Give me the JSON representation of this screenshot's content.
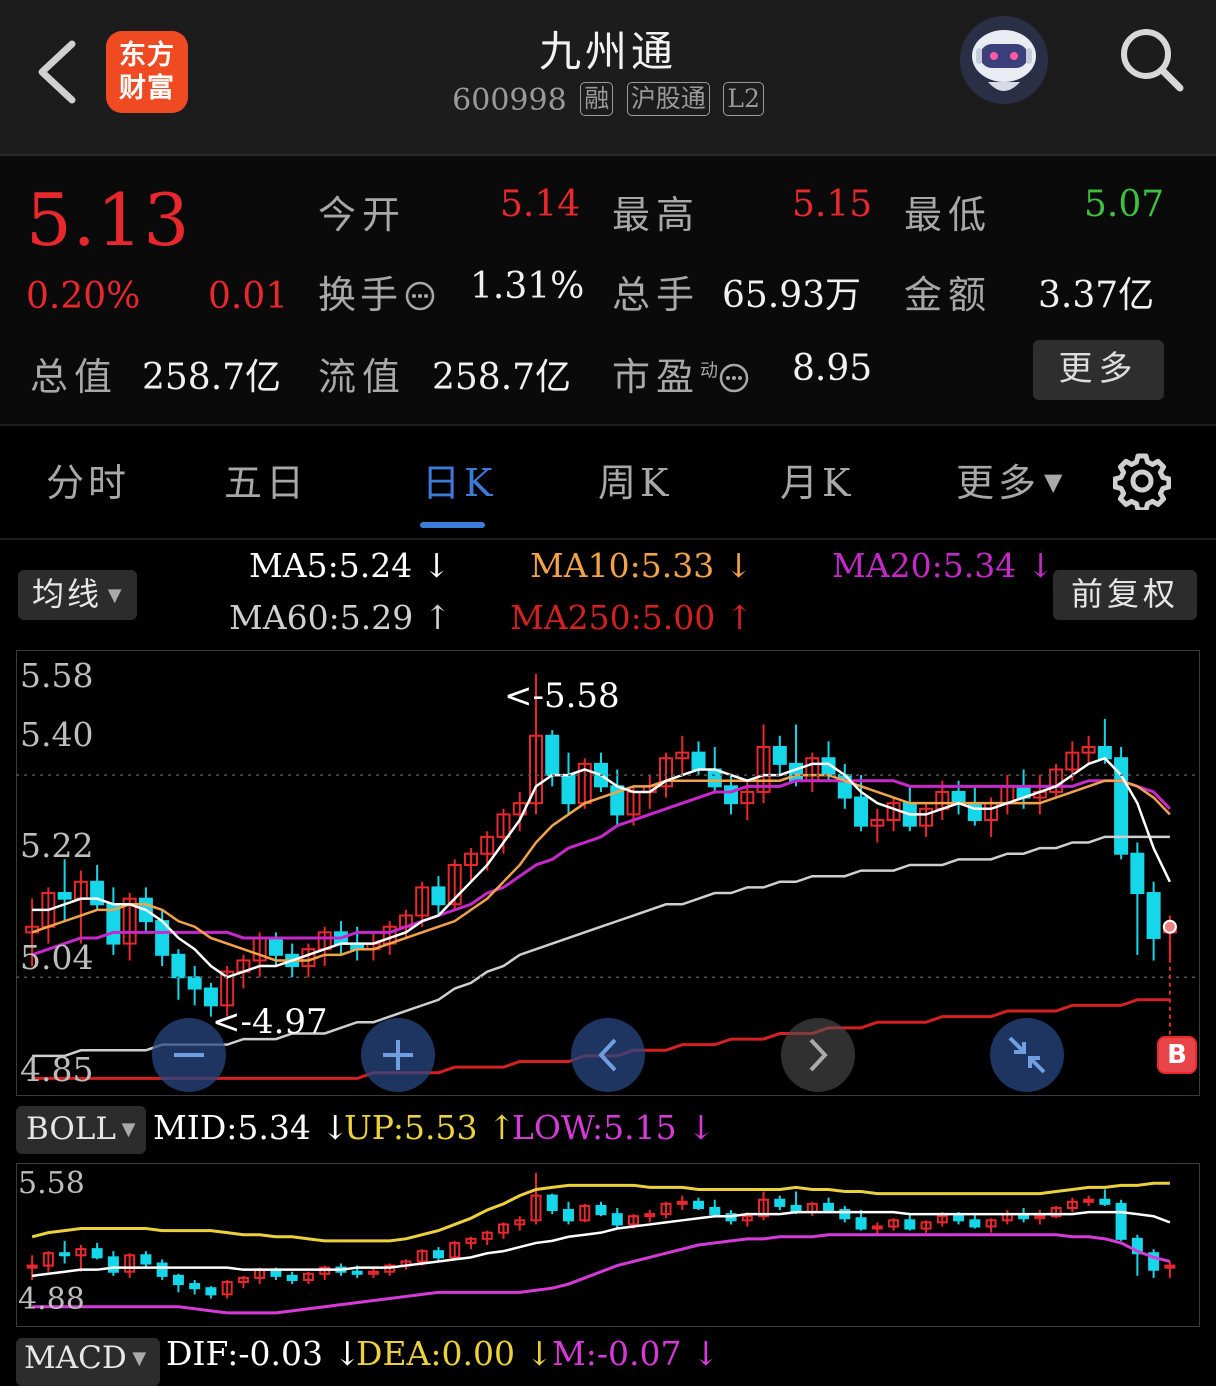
{
  "header": {
    "title": "九州通",
    "code": "600998",
    "tags": [
      "融",
      "沪股通",
      "L2"
    ],
    "logo_line1": "东方",
    "logo_line2": "财富"
  },
  "quote": {
    "price": "5.13",
    "change_pct": "0.20%",
    "change": "0.01",
    "open_label": "今开",
    "open": "5.14",
    "high_label": "最高",
    "high": "5.15",
    "low_label": "最低",
    "low": "5.07",
    "turnover_label": "换手",
    "turnover": "1.31%",
    "volume_label": "总手",
    "volume": "65.93万",
    "amount_label": "金额",
    "amount": "3.37亿",
    "mktcap_label": "总值",
    "mktcap": "258.7亿",
    "float_label": "流值",
    "float_cap": "258.7亿",
    "pe_label": "市盈",
    "pe_sup": "动",
    "pe": "8.95",
    "more": "更多"
  },
  "tabs": [
    "分时",
    "五日",
    "日K",
    "周K",
    "月K",
    "更多"
  ],
  "indicator_bar": {
    "ma_button": "均线",
    "adjust_button": "前复权",
    "ma5": "MA5:5.24",
    "ma10": "MA10:5.33",
    "ma20": "MA20:5.34",
    "ma60": "MA60:5.29",
    "ma250": "MA250:5.00",
    "down_arrow": "↓",
    "up_arrow": "↑"
  },
  "main_chart": {
    "y_labels": [
      "5.58",
      "5.40",
      "5.22",
      "5.04",
      "4.85"
    ],
    "max_marker": "<-5.58",
    "min_marker": "<-4.97",
    "b_marker": "B"
  },
  "boll_bar": {
    "button": "BOLL",
    "mid": "MID:5.34",
    "up": "UP:5.53",
    "low": "LOW:5.15"
  },
  "boll_chart": {
    "y_labels": [
      "5.58",
      "4.88"
    ]
  },
  "macd_bar": {
    "button": "MACD",
    "dif": "DIF:-0.03",
    "dea": "DEA:0.00",
    "m": "M:-0.07"
  },
  "colors": {
    "up": "#e8282d",
    "down": "#16d7ea",
    "ma5": "#ffffff",
    "ma10": "#f2a34a",
    "ma20": "#c628c9",
    "ma60": "#cfcfcf",
    "ma250": "#d42020",
    "accent": "#3d7bd8"
  },
  "chart_data": {
    "type": "candlestick",
    "ylim": [
      4.85,
      5.58
    ],
    "candles": [
      [
        5.12,
        5.18,
        5.06,
        5.13
      ],
      [
        5.13,
        5.2,
        5.1,
        5.19
      ],
      [
        5.19,
        5.25,
        5.14,
        5.18
      ],
      [
        5.18,
        5.23,
        5.1,
        5.21
      ],
      [
        5.21,
        5.24,
        5.16,
        5.17
      ],
      [
        5.17,
        5.2,
        5.08,
        5.1
      ],
      [
        5.1,
        5.19,
        5.07,
        5.18
      ],
      [
        5.18,
        5.2,
        5.12,
        5.14
      ],
      [
        5.14,
        5.16,
        5.06,
        5.08
      ],
      [
        5.08,
        5.09,
        5.0,
        5.04
      ],
      [
        5.04,
        5.06,
        4.99,
        5.02
      ],
      [
        5.02,
        5.03,
        4.97,
        4.99
      ],
      [
        4.99,
        5.06,
        4.97,
        5.05
      ],
      [
        5.05,
        5.08,
        5.02,
        5.07
      ],
      [
        5.07,
        5.12,
        5.04,
        5.11
      ],
      [
        5.11,
        5.12,
        5.06,
        5.08
      ],
      [
        5.08,
        5.1,
        5.04,
        5.06
      ],
      [
        5.06,
        5.1,
        5.04,
        5.09
      ],
      [
        5.09,
        5.13,
        5.06,
        5.12
      ],
      [
        5.12,
        5.14,
        5.08,
        5.1
      ],
      [
        5.1,
        5.13,
        5.07,
        5.09
      ],
      [
        5.09,
        5.12,
        5.07,
        5.1
      ],
      [
        5.1,
        5.14,
        5.08,
        5.13
      ],
      [
        5.13,
        5.16,
        5.11,
        5.15
      ],
      [
        5.15,
        5.21,
        5.13,
        5.2
      ],
      [
        5.2,
        5.22,
        5.15,
        5.17
      ],
      [
        5.17,
        5.25,
        5.16,
        5.24
      ],
      [
        5.24,
        5.27,
        5.21,
        5.26
      ],
      [
        5.26,
        5.3,
        5.23,
        5.29
      ],
      [
        5.29,
        5.34,
        5.26,
        5.33
      ],
      [
        5.33,
        5.37,
        5.3,
        5.35
      ],
      [
        5.35,
        5.58,
        5.33,
        5.47
      ],
      [
        5.47,
        5.48,
        5.38,
        5.4
      ],
      [
        5.4,
        5.44,
        5.33,
        5.35
      ],
      [
        5.35,
        5.43,
        5.34,
        5.42
      ],
      [
        5.42,
        5.44,
        5.37,
        5.38
      ],
      [
        5.38,
        5.41,
        5.31,
        5.33
      ],
      [
        5.33,
        5.38,
        5.31,
        5.37
      ],
      [
        5.37,
        5.4,
        5.34,
        5.38
      ],
      [
        5.38,
        5.44,
        5.36,
        5.43
      ],
      [
        5.43,
        5.47,
        5.4,
        5.44
      ],
      [
        5.44,
        5.46,
        5.4,
        5.41
      ],
      [
        5.41,
        5.45,
        5.37,
        5.38
      ],
      [
        5.38,
        5.4,
        5.33,
        5.35
      ],
      [
        5.35,
        5.39,
        5.32,
        5.37
      ],
      [
        5.37,
        5.49,
        5.35,
        5.45
      ],
      [
        5.45,
        5.47,
        5.4,
        5.42
      ],
      [
        5.42,
        5.49,
        5.38,
        5.39
      ],
      [
        5.39,
        5.44,
        5.37,
        5.43
      ],
      [
        5.43,
        5.46,
        5.39,
        5.4
      ],
      [
        5.4,
        5.42,
        5.34,
        5.36
      ],
      [
        5.36,
        5.4,
        5.3,
        5.31
      ],
      [
        5.31,
        5.34,
        5.28,
        5.32
      ],
      [
        5.32,
        5.36,
        5.3,
        5.35
      ],
      [
        5.35,
        5.38,
        5.3,
        5.31
      ],
      [
        5.31,
        5.35,
        5.29,
        5.34
      ],
      [
        5.34,
        5.39,
        5.32,
        5.37
      ],
      [
        5.37,
        5.39,
        5.33,
        5.35
      ],
      [
        5.35,
        5.38,
        5.31,
        5.32
      ],
      [
        5.32,
        5.36,
        5.29,
        5.35
      ],
      [
        5.35,
        5.4,
        5.33,
        5.38
      ],
      [
        5.38,
        5.41,
        5.34,
        5.36
      ],
      [
        5.36,
        5.4,
        5.33,
        5.37
      ],
      [
        5.37,
        5.42,
        5.36,
        5.41
      ],
      [
        5.41,
        5.46,
        5.39,
        5.44
      ],
      [
        5.44,
        5.47,
        5.42,
        5.45
      ],
      [
        5.45,
        5.5,
        5.42,
        5.43
      ],
      [
        5.43,
        5.45,
        5.25,
        5.26
      ],
      [
        5.26,
        5.28,
        5.08,
        5.19
      ],
      [
        5.19,
        5.21,
        5.07,
        5.11
      ],
      [
        5.12,
        5.15,
        5.07,
        5.13
      ]
    ],
    "ma5": [
      5.16,
      5.16,
      5.17,
      5.18,
      5.18,
      5.17,
      5.17,
      5.16,
      5.14,
      5.11,
      5.09,
      5.06,
      5.04,
      5.05,
      5.06,
      5.06,
      5.07,
      5.08,
      5.09,
      5.1,
      5.1,
      5.1,
      5.11,
      5.12,
      5.14,
      5.15,
      5.18,
      5.21,
      5.24,
      5.28,
      5.32,
      5.38,
      5.4,
      5.4,
      5.41,
      5.4,
      5.38,
      5.37,
      5.37,
      5.39,
      5.4,
      5.41,
      5.41,
      5.4,
      5.39,
      5.4,
      5.4,
      5.41,
      5.42,
      5.42,
      5.4,
      5.37,
      5.35,
      5.34,
      5.33,
      5.33,
      5.34,
      5.35,
      5.34,
      5.34,
      5.35,
      5.36,
      5.37,
      5.38,
      5.4,
      5.42,
      5.43,
      5.4,
      5.35,
      5.27,
      5.21
    ],
    "ma10": [
      5.12,
      5.13,
      5.14,
      5.15,
      5.16,
      5.16,
      5.17,
      5.17,
      5.16,
      5.14,
      5.13,
      5.11,
      5.1,
      5.09,
      5.08,
      5.07,
      5.07,
      5.07,
      5.08,
      5.08,
      5.09,
      5.09,
      5.1,
      5.11,
      5.12,
      5.13,
      5.14,
      5.16,
      5.18,
      5.21,
      5.24,
      5.28,
      5.31,
      5.33,
      5.35,
      5.36,
      5.37,
      5.38,
      5.38,
      5.39,
      5.39,
      5.39,
      5.39,
      5.39,
      5.39,
      5.39,
      5.39,
      5.4,
      5.4,
      5.4,
      5.39,
      5.38,
      5.37,
      5.36,
      5.35,
      5.35,
      5.35,
      5.35,
      5.35,
      5.35,
      5.35,
      5.35,
      5.35,
      5.36,
      5.37,
      5.38,
      5.39,
      5.39,
      5.38,
      5.36,
      5.33
    ],
    "ma20": [
      5.08,
      5.09,
      5.1,
      5.11,
      5.11,
      5.12,
      5.12,
      5.12,
      5.12,
      5.12,
      5.12,
      5.12,
      5.12,
      5.11,
      5.11,
      5.11,
      5.11,
      5.11,
      5.11,
      5.11,
      5.12,
      5.12,
      5.12,
      5.13,
      5.14,
      5.15,
      5.16,
      5.17,
      5.19,
      5.2,
      5.22,
      5.24,
      5.25,
      5.27,
      5.28,
      5.29,
      5.31,
      5.32,
      5.33,
      5.34,
      5.35,
      5.36,
      5.37,
      5.37,
      5.38,
      5.38,
      5.38,
      5.39,
      5.39,
      5.39,
      5.39,
      5.39,
      5.39,
      5.39,
      5.38,
      5.38,
      5.38,
      5.38,
      5.38,
      5.38,
      5.38,
      5.38,
      5.38,
      5.38,
      5.38,
      5.39,
      5.39,
      5.39,
      5.38,
      5.37,
      5.34
    ],
    "ma60": [
      4.9,
      4.9,
      4.9,
      4.91,
      4.91,
      4.91,
      4.91,
      4.91,
      4.92,
      4.92,
      4.92,
      4.92,
      4.92,
      4.93,
      4.93,
      4.93,
      4.94,
      4.94,
      4.94,
      4.95,
      4.96,
      4.96,
      4.97,
      4.98,
      4.99,
      5.0,
      5.02,
      5.03,
      5.05,
      5.06,
      5.08,
      5.09,
      5.1,
      5.11,
      5.12,
      5.13,
      5.14,
      5.15,
      5.16,
      5.17,
      5.17,
      5.18,
      5.19,
      5.19,
      5.2,
      5.2,
      5.21,
      5.21,
      5.22,
      5.22,
      5.22,
      5.23,
      5.23,
      5.23,
      5.24,
      5.24,
      5.24,
      5.25,
      5.25,
      5.25,
      5.26,
      5.26,
      5.27,
      5.27,
      5.28,
      5.28,
      5.29,
      5.29,
      5.29,
      5.29,
      5.29
    ],
    "ma250": [
      4.86,
      4.86,
      4.86,
      4.86,
      4.86,
      4.86,
      4.86,
      4.86,
      4.86,
      4.86,
      4.86,
      4.86,
      4.86,
      4.86,
      4.86,
      4.86,
      4.86,
      4.86,
      4.86,
      4.86,
      4.86,
      4.87,
      4.87,
      4.87,
      4.87,
      4.87,
      4.88,
      4.88,
      4.88,
      4.88,
      4.89,
      4.89,
      4.89,
      4.89,
      4.9,
      4.9,
      4.9,
      4.91,
      4.91,
      4.91,
      4.92,
      4.92,
      4.92,
      4.93,
      4.93,
      4.93,
      4.94,
      4.94,
      4.94,
      4.95,
      4.95,
      4.95,
      4.96,
      4.96,
      4.96,
      4.96,
      4.97,
      4.97,
      4.97,
      4.97,
      4.98,
      4.98,
      4.98,
      4.98,
      4.99,
      4.99,
      4.99,
      4.99,
      5.0,
      5.0,
      5.0
    ],
    "boll_ylim": [
      4.88,
      5.58
    ],
    "boll_up": [
      5.27,
      5.29,
      5.3,
      5.31,
      5.31,
      5.31,
      5.31,
      5.31,
      5.3,
      5.3,
      5.3,
      5.3,
      5.29,
      5.28,
      5.28,
      5.27,
      5.27,
      5.26,
      5.25,
      5.25,
      5.25,
      5.25,
      5.25,
      5.26,
      5.28,
      5.3,
      5.33,
      5.36,
      5.4,
      5.43,
      5.47,
      5.5,
      5.51,
      5.52,
      5.52,
      5.52,
      5.52,
      5.52,
      5.51,
      5.51,
      5.51,
      5.5,
      5.5,
      5.5,
      5.5,
      5.5,
      5.5,
      5.51,
      5.5,
      5.5,
      5.49,
      5.49,
      5.48,
      5.48,
      5.48,
      5.48,
      5.48,
      5.48,
      5.48,
      5.48,
      5.48,
      5.48,
      5.48,
      5.49,
      5.5,
      5.51,
      5.51,
      5.52,
      5.52,
      5.53,
      5.53
    ],
    "boll_mid": [
      5.08,
      5.09,
      5.1,
      5.11,
      5.11,
      5.12,
      5.12,
      5.12,
      5.12,
      5.12,
      5.12,
      5.12,
      5.12,
      5.11,
      5.11,
      5.11,
      5.11,
      5.11,
      5.11,
      5.11,
      5.12,
      5.12,
      5.12,
      5.13,
      5.14,
      5.15,
      5.16,
      5.17,
      5.19,
      5.2,
      5.22,
      5.24,
      5.25,
      5.27,
      5.28,
      5.29,
      5.31,
      5.32,
      5.33,
      5.34,
      5.35,
      5.36,
      5.37,
      5.37,
      5.38,
      5.38,
      5.38,
      5.39,
      5.39,
      5.39,
      5.39,
      5.39,
      5.39,
      5.39,
      5.38,
      5.38,
      5.38,
      5.38,
      5.38,
      5.38,
      5.38,
      5.38,
      5.38,
      5.38,
      5.38,
      5.39,
      5.39,
      5.39,
      5.38,
      5.37,
      5.34
    ],
    "boll_low": [
      4.93,
      4.93,
      4.93,
      4.93,
      4.93,
      4.93,
      4.93,
      4.93,
      4.93,
      4.93,
      4.92,
      4.91,
      4.9,
      4.9,
      4.9,
      4.9,
      4.91,
      4.92,
      4.93,
      4.94,
      4.95,
      4.96,
      4.97,
      4.98,
      4.99,
      5.0,
      5.0,
      5.0,
      5.0,
      5.0,
      5.0,
      5.01,
      5.02,
      5.04,
      5.07,
      5.1,
      5.13,
      5.15,
      5.17,
      5.19,
      5.21,
      5.23,
      5.24,
      5.25,
      5.26,
      5.26,
      5.27,
      5.27,
      5.27,
      5.28,
      5.28,
      5.28,
      5.28,
      5.28,
      5.28,
      5.28,
      5.28,
      5.28,
      5.28,
      5.28,
      5.28,
      5.28,
      5.28,
      5.28,
      5.27,
      5.27,
      5.26,
      5.24,
      5.2,
      5.17,
      5.15
    ]
  }
}
